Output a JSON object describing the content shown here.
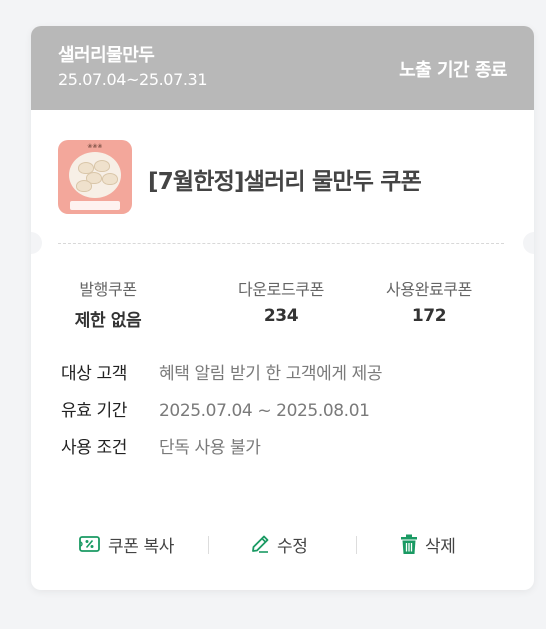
{
  "header": {
    "title": "샐러리물만두",
    "period": "25.07.04~25.07.31",
    "status": "노출 기간 종료"
  },
  "coupon": {
    "name": "[7월한정]샐러리 물만두 쿠폰"
  },
  "stats": [
    {
      "label": "발행쿠폰",
      "value": "제한 없음"
    },
    {
      "label": "다운로드쿠폰",
      "value": "234"
    },
    {
      "label": "사용완료쿠폰",
      "value": "172"
    }
  ],
  "info": [
    {
      "key": "대상 고객",
      "value": "혜택 알림 받기 한 고객에게 제공"
    },
    {
      "key": "유효 기간",
      "value": "2025.07.04 ~ 2025.08.01"
    },
    {
      "key": "사용 조건",
      "value": "단독 사용 불가"
    }
  ],
  "actions": {
    "copy_label": "쿠폰 복사",
    "edit_label": "수정",
    "delete_label": "삭제"
  },
  "colors": {
    "header_bg": "#b8b8b8",
    "accent_green": "#1a9a63",
    "page_bg": "#f3f4f6"
  },
  "icons": {
    "copy": "coupon-percent-icon",
    "edit": "pencil-icon",
    "delete": "trash-icon"
  }
}
